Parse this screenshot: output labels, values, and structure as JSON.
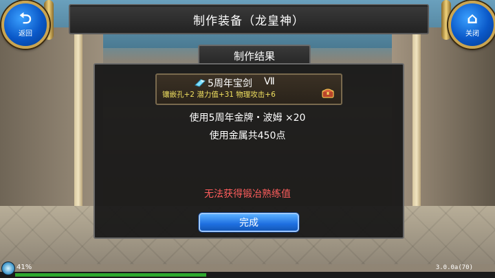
{
  "header": {
    "title": "制作装备（龙皇神）"
  },
  "nav": {
    "back_label": "返回",
    "back_icon": "back-arrow-icon",
    "close_label": "关闭",
    "close_icon": "home-icon"
  },
  "panel": {
    "title": "制作结果",
    "item": {
      "name": "5周年宝剑",
      "grade": "Ⅶ",
      "stats": "镶嵌孔+2  潜力值+31  物理攻击+6",
      "icon": "gem-icon",
      "badge_icon": "chest-icon"
    },
    "materials_line": "使用5周年金牌・波姆 ×20",
    "metal_line": "使用金属共450点",
    "warning": "无法获得锻冶熟练值",
    "done_label": "完成",
    "warning_color": "#ff5d5d",
    "stats_color": "#f0e060"
  },
  "status": {
    "percent": "41%",
    "progress_fraction": 0.41,
    "version": "3.0.0a(70)"
  }
}
